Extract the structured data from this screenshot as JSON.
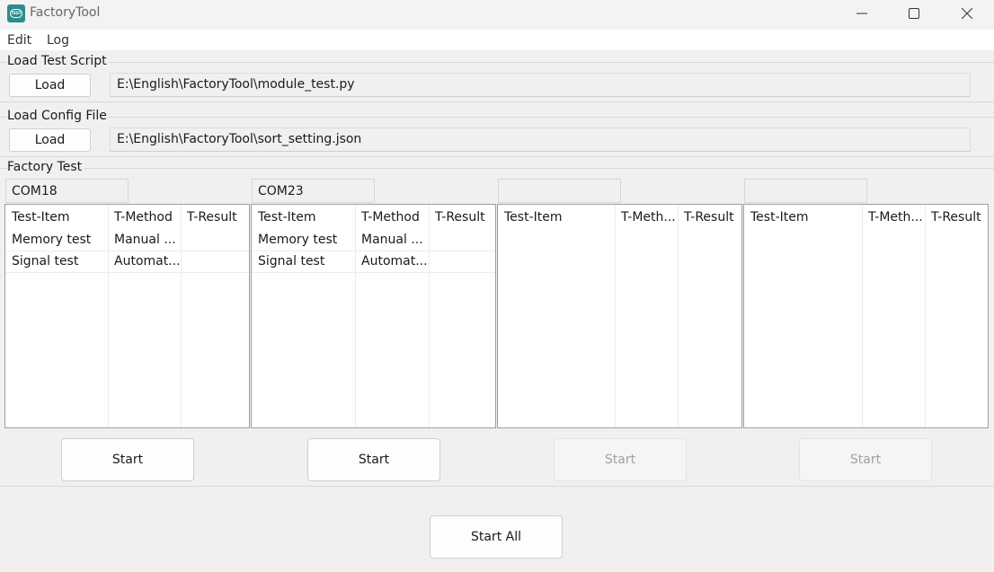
{
  "window": {
    "title": "FactoryTool",
    "icon": "factorytool-app-icon",
    "controls": [
      "minimize-icon",
      "maximize-icon",
      "close-icon"
    ]
  },
  "menu": [
    "Edit",
    "Log"
  ],
  "script_section": {
    "label": "Load Test Script",
    "button": "Load",
    "path": "E:\\English\\FactoryTool\\module_test.py"
  },
  "config_section": {
    "label": "Load Config File",
    "button": "Load",
    "path": "E:\\English\\FactoryTool\\sort_setting.json"
  },
  "factory_test": {
    "label": "Factory Test",
    "ports": [
      {
        "port": "COM18",
        "headers": [
          "Test-Item",
          "T-Method",
          "T-Result"
        ],
        "rows": [
          [
            "Memory test",
            "Manual ...",
            ""
          ],
          [
            "Signal test",
            "Automat...",
            ""
          ]
        ],
        "start_label": "Start",
        "start_enabled": true
      },
      {
        "port": "COM23",
        "headers": [
          "Test-Item",
          "T-Method",
          "T-Result"
        ],
        "rows": [
          [
            "Memory test",
            "Manual ...",
            ""
          ],
          [
            "Signal test",
            "Automat...",
            ""
          ]
        ],
        "start_label": "Start",
        "start_enabled": true
      },
      {
        "port": "",
        "headers": [
          "Test-Item",
          "T-Meth...",
          "T-Result"
        ],
        "rows": [],
        "start_label": "Start",
        "start_enabled": false
      },
      {
        "port": "",
        "headers": [
          "Test-Item",
          "T-Meth...",
          "T-Result"
        ],
        "rows": [],
        "start_label": "Start",
        "start_enabled": false
      }
    ]
  },
  "start_all_label": "Start All"
}
